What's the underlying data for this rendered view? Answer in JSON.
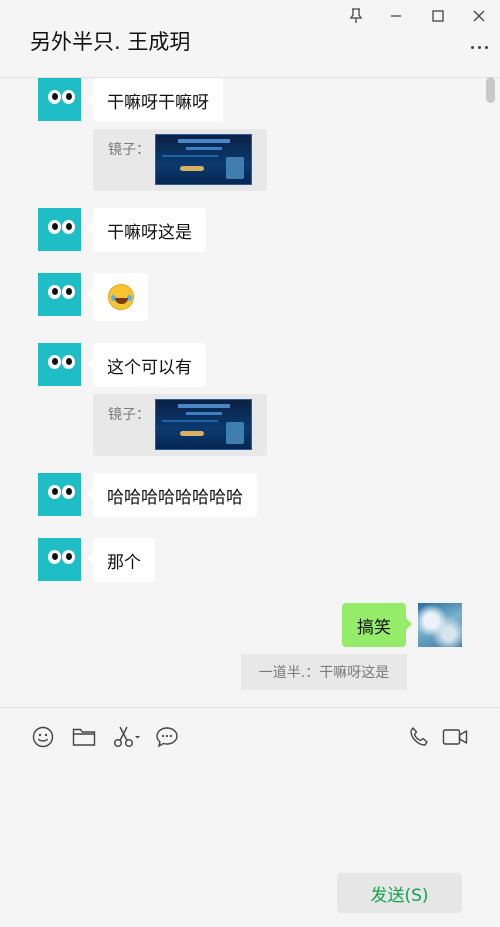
{
  "header": {
    "title": "另外半只. 王成玥"
  },
  "messages": [
    {
      "text": "干嘛呀干嘛呀"
    },
    {
      "quote_label": "镜子："
    },
    {
      "text": "干嘛呀这是"
    },
    {
      "emoji": "laughing-tears-emoji"
    },
    {
      "text": "这个可以有"
    },
    {
      "quote_label": "镜子："
    },
    {
      "text": "哈哈哈哈哈哈哈哈"
    },
    {
      "text": "那个"
    }
  ],
  "self_message": {
    "text": "搞笑",
    "quote": "一道半.：干嘛呀这是"
  },
  "composer": {
    "send_label": "发送(S)"
  },
  "colors": {
    "accent_green": "#95ec69",
    "avatar_teal": "#1fbdc6",
    "send_text": "#0fa34a"
  },
  "icons": [
    "pin-icon",
    "minimize-icon",
    "maximize-icon",
    "close-icon",
    "more-icon",
    "emoji-icon",
    "folder-icon",
    "scissors-icon",
    "chat-bubble-icon",
    "phone-icon",
    "video-icon"
  ]
}
